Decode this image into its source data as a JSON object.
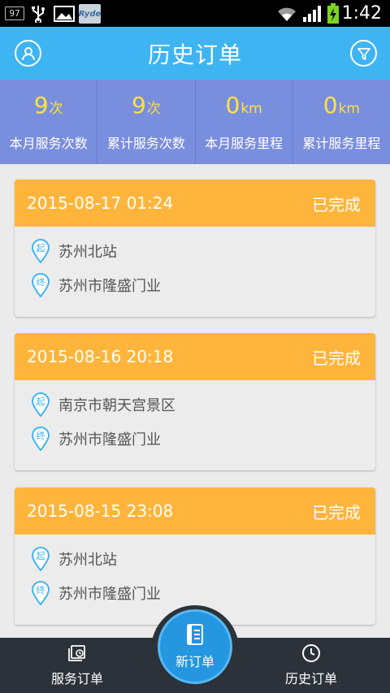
{
  "status_bar": {
    "battery_level": "97",
    "app_badge": "Ryde",
    "time": "1:42"
  },
  "header": {
    "title": "历史订单",
    "left_icon": "user-icon",
    "right_icon": "filter-icon"
  },
  "stats": [
    {
      "value": "9",
      "unit": "次",
      "label": "本月服务次数"
    },
    {
      "value": "9",
      "unit": "次",
      "label": "累计服务次数"
    },
    {
      "value": "0",
      "unit": "km",
      "label": "本月服务里程"
    },
    {
      "value": "0",
      "unit": "km",
      "label": "累计服务里程"
    }
  ],
  "orders": [
    {
      "datetime": "2015-08-17 01:24",
      "status": "已完成",
      "start_tag": "起",
      "start": "苏州北站",
      "end_tag": "终",
      "end": "苏州市隆盛门业"
    },
    {
      "datetime": "2015-08-16 20:18",
      "status": "已完成",
      "start_tag": "起",
      "start": "南京市朝天宫景区",
      "end_tag": "终",
      "end": "苏州市隆盛门业"
    },
    {
      "datetime": "2015-08-15 23:08",
      "status": "已完成",
      "start_tag": "起",
      "start": "苏州北站",
      "end_tag": "终",
      "end": "苏州市隆盛门业"
    }
  ],
  "bottom_nav": {
    "left_label": "服务订单",
    "center_label": "新订单",
    "right_label": "历史订单"
  },
  "colors": {
    "header": "#3fb4f2",
    "stats_bg": "#7a8ede",
    "stat_value": "#ffe33a",
    "card_header": "#ffb53c",
    "pin": "#3fb4f2",
    "bottom_bar": "#2c3239",
    "center_button": "#2596e0"
  }
}
